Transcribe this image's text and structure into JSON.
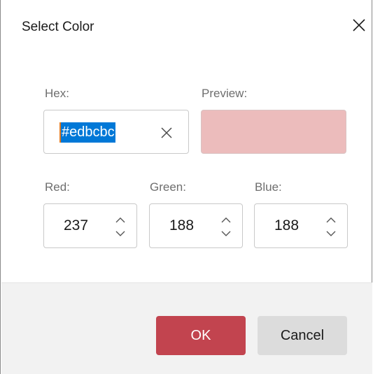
{
  "dialog": {
    "title": "Select Color"
  },
  "hex": {
    "label": "Hex:",
    "value": "#edbcbc"
  },
  "preview": {
    "label": "Preview:",
    "color": "#ecbcbc"
  },
  "channels": [
    {
      "label": "Red:",
      "value": "237"
    },
    {
      "label": "Green:",
      "value": "188"
    },
    {
      "label": "Blue:",
      "value": "188"
    }
  ],
  "buttons": {
    "ok": "OK",
    "cancel": "Cancel"
  },
  "colors": {
    "accent": "#c2444f",
    "selection": "#0078d7"
  },
  "icons": {
    "close": "close-icon",
    "clear": "clear-icon",
    "up": "chevron-up-icon",
    "down": "chevron-down-icon"
  }
}
